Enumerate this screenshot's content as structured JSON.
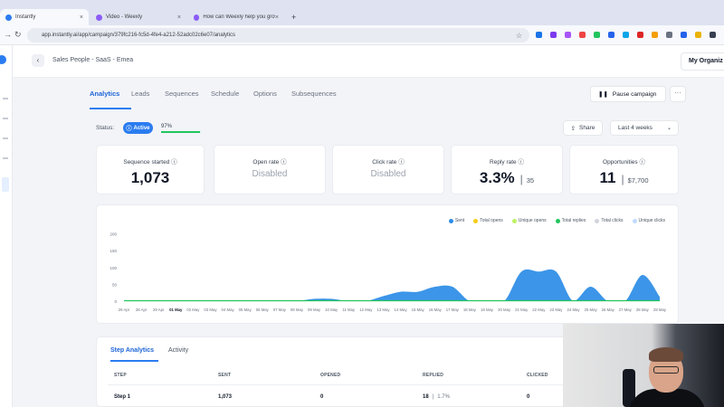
{
  "browser": {
    "tabs": [
      {
        "title": "Instantly",
        "favicon_color": "#2b7cf0"
      },
      {
        "title": "Video - Weexly",
        "favicon_color": "#8b5cf6"
      },
      {
        "title": "How can Weexly help you grow...",
        "favicon_color": "#8b5cf6"
      }
    ],
    "new_tab": "+",
    "url": "app.instantly.ai/app/campaign/379fc216-fc5d-4fe4-a212-52adc02c6e07/analytics"
  },
  "header": {
    "breadcrumb": "Sales People - SaaS - Emea",
    "org": "My Organiz"
  },
  "campaign_tabs": [
    "Analytics",
    "Leads",
    "Sequences",
    "Schedule",
    "Options",
    "Subsequences"
  ],
  "actions": {
    "pause": "Pause campaign",
    "more": "···"
  },
  "status": {
    "label": "Status:",
    "badge": "Active",
    "progress_text": "97%",
    "progress_pct": 97,
    "share": "Share",
    "range": "Last 4 weeks"
  },
  "metrics": [
    {
      "label": "Sequence started ⓘ",
      "value": "1,073"
    },
    {
      "label": "Open rate ⓘ",
      "value": "Disabled"
    },
    {
      "label": "Click rate ⓘ",
      "value": "Disabled"
    },
    {
      "label": "Reply rate ⓘ",
      "value": "3.3%",
      "sub": "35"
    },
    {
      "label": "Opportunities ⓘ",
      "value": "11",
      "sub": "$7,700"
    }
  ],
  "chart_data": {
    "type": "area",
    "legend_position": "top-right",
    "grid": false,
    "series": [
      {
        "name": "Sent",
        "color": "#2b8ce6",
        "values": [
          0,
          0,
          0,
          0,
          0,
          0,
          0,
          0,
          0,
          0,
          0,
          7,
          7,
          0,
          0,
          15,
          28,
          28,
          43,
          43,
          0,
          0,
          0,
          88,
          88,
          88,
          0,
          43,
          0,
          0,
          78,
          13
        ]
      },
      {
        "name": "Total opens",
        "color": "#facc15",
        "values": []
      },
      {
        "name": "Unique opens",
        "color": "#bef264",
        "values": []
      },
      {
        "name": "Total replies",
        "color": "#22c55e",
        "values": [
          0,
          0,
          0,
          0,
          0,
          0,
          0,
          0,
          0,
          0,
          0,
          0,
          0,
          0,
          0,
          0,
          0,
          0,
          0,
          0,
          0,
          0,
          0,
          0,
          0,
          0,
          0,
          0,
          0,
          0,
          0,
          0
        ]
      },
      {
        "name": "Total clicks",
        "color": "#d1d5db",
        "values": []
      },
      {
        "name": "Unique clicks",
        "color": "#bfdbfe",
        "values": []
      }
    ],
    "x": [
      "29 Apr",
      "28 Apr",
      "29 Apr",
      "01 May",
      "02 May",
      "03 May",
      "04 May",
      "05 May",
      "06 May",
      "07 May",
      "08 May",
      "09 May",
      "10 May",
      "11 May",
      "12 May",
      "13 May",
      "14 May",
      "15 May",
      "16 May",
      "17 May",
      "18 May",
      "19 May",
      "20 May",
      "21 May",
      "22 May",
      "23 May",
      "24 May",
      "25 May",
      "26 May",
      "27 May",
      "28 May",
      "29 May"
    ],
    "bold_ticks": [
      "01 May"
    ],
    "yticks": [
      0,
      50,
      100,
      150,
      200
    ],
    "ytick_labels": [
      "0",
      "50",
      "100",
      "150",
      "200"
    ],
    "ylim": [
      0,
      215
    ]
  },
  "step_analytics": {
    "tabs": [
      "Step Analytics",
      "Activity"
    ],
    "columns": [
      "STEP",
      "SENT",
      "OPENED",
      "REPLIED",
      "CLICKED"
    ],
    "rows": [
      {
        "step": "Step 1",
        "sent": "1,073",
        "opened": "0",
        "replied": "18",
        "replied_pct": "1.7%",
        "clicked": "0"
      }
    ]
  }
}
